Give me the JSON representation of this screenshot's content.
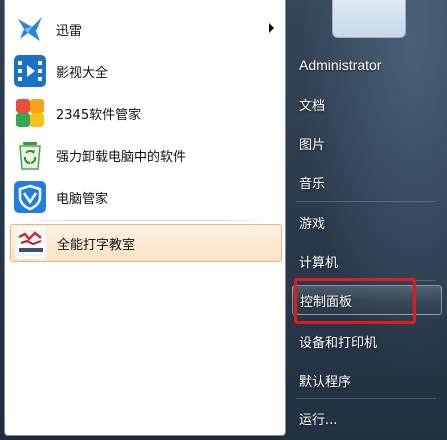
{
  "programs": [
    {
      "label": "迅雷",
      "icon": "thunder-bird-icon",
      "has_submenu": true
    },
    {
      "label": "影视大全",
      "icon": "video-film-icon"
    },
    {
      "label": "2345软件管家",
      "icon": "colorful-tiles-icon"
    },
    {
      "label": "强力卸载电脑中的软件",
      "icon": "recycle-bin-icon"
    },
    {
      "label": "电脑管家",
      "icon": "shield-icon"
    },
    {
      "label": "全能打字教室",
      "icon": "typing-school-icon",
      "selected": true
    }
  ],
  "right_links": [
    {
      "label": "Administrator"
    },
    {
      "label": "文档"
    },
    {
      "label": "图片"
    },
    {
      "label": "音乐"
    },
    {
      "label": "游戏"
    },
    {
      "label": "计算机"
    },
    {
      "label": "控制面板",
      "hovered": true,
      "annotated": true
    },
    {
      "label": "设备和打印机"
    },
    {
      "label": "默认程序"
    },
    {
      "label": "运行..."
    }
  ],
  "colors": {
    "annotation_border": "#e21a1a",
    "selected_fill": "#fbe3c5",
    "panel_dark": "#2a3a4c"
  }
}
